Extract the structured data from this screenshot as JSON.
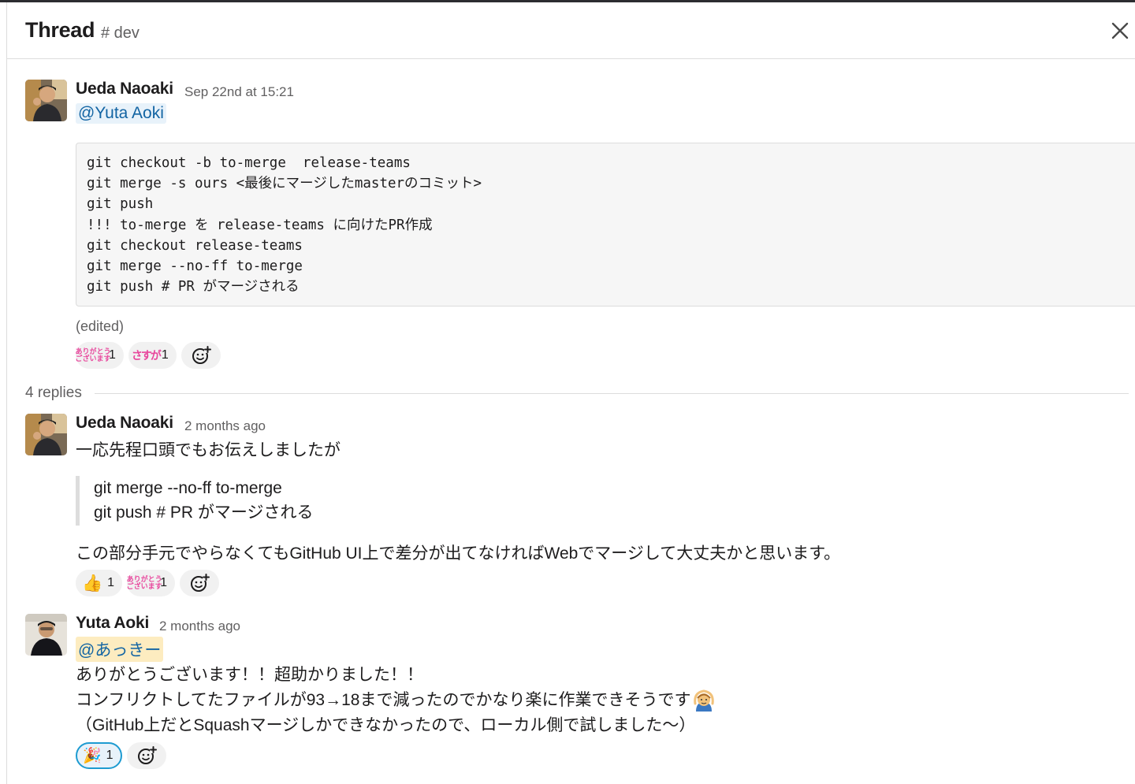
{
  "header": {
    "title": "Thread",
    "channel": "# dev"
  },
  "parent": {
    "author": "Ueda Naoaki",
    "timestamp": "Sep 22nd at 15:21",
    "mention": "@Yuta Aoki",
    "code_lines": [
      "git checkout -b to-merge  release-teams",
      "git merge -s ours <最後にマージしたmasterのコミット>",
      "git push",
      "!!! to-merge を release-teams に向けたPR作成",
      "git checkout release-teams",
      "git merge --no-ff to-merge",
      "git push # PR がマージされる"
    ],
    "edited_label": "(edited)",
    "reactions": [
      {
        "emoji": "arigatou-gozaimasu",
        "emoji_text": [
          "ありがとう",
          "ございます"
        ],
        "count": "1"
      },
      {
        "emoji": "sasuga",
        "emoji_text": [
          "さすが"
        ],
        "count": "1"
      }
    ]
  },
  "replies_label": "4 replies",
  "reply1": {
    "author": "Ueda Naoaki",
    "timestamp": "2 months ago",
    "text1": "一応先程口頭でもお伝えしましたが",
    "quote_lines": [
      "git merge --no-ff to-merge",
      "git push # PR がマージされる"
    ],
    "text2": "この部分手元でやらなくてもGitHub UI上で差分が出てなければWebでマージして大丈夫かと思います。",
    "reactions": [
      {
        "emoji": "thumbsup",
        "glyph": "👍",
        "count": "1"
      },
      {
        "emoji": "arigatou-gozaimasu",
        "emoji_text": [
          "ありがとう",
          "ございます"
        ],
        "count": "1"
      }
    ]
  },
  "reply2": {
    "author": "Yuta Aoki",
    "timestamp": "2 months ago",
    "mention": "@あっきー",
    "line1": "ありがとうございます！！超助かりました！！",
    "line2": "コンフリクトしてたファイルが93→18まで減ったのでかなり楽に作業できそうです",
    "line3": "（GitHub上だとSquashマージしかできなかったので、ローカル側で試しました〜）",
    "reactions": [
      {
        "emoji": "tada",
        "glyph": "🎉",
        "count": "1",
        "active": true
      }
    ]
  },
  "colors": {
    "link": "#1264a3",
    "mention_bg": "#e8f2fa",
    "mention_self_bg": "#fdecc0",
    "active_reaction_border": "#1d9bd1"
  }
}
